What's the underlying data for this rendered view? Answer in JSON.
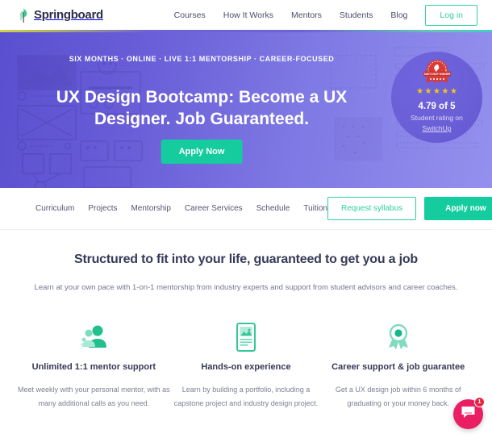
{
  "topnav": {
    "brand": "Springboard",
    "links": [
      {
        "label": "Courses"
      },
      {
        "label": "How It Works"
      },
      {
        "label": "Mentors"
      },
      {
        "label": "Students"
      },
      {
        "label": "Blog"
      }
    ],
    "login_label": "Log in"
  },
  "hero": {
    "eyebrow": "SIX MONTHS · ONLINE · LIVE 1:1 MENTORSHIP · CAREER-FOCUSED",
    "title": "UX Design Bootcamp: Become a UX Designer. Job Guaranteed.",
    "cta_label": "Apply Now",
    "rating": {
      "stars": 5,
      "score": "4.79 of 5",
      "caption": "Student rating on",
      "source": "SwitchUp"
    },
    "colors": {
      "gradient_start": "#5a4fcf",
      "gradient_end": "#9490ee",
      "cta_green": "#14cc9e"
    }
  },
  "subnav": {
    "links": [
      {
        "label": "Curriculum"
      },
      {
        "label": "Projects"
      },
      {
        "label": "Mentorship"
      },
      {
        "label": "Career Services"
      },
      {
        "label": "Schedule"
      },
      {
        "label": "Tuition"
      }
    ],
    "syllabus_label": "Request syllabus",
    "apply_label": "Apply now"
  },
  "main": {
    "title": "Structured to fit into your life, guaranteed to get you a job",
    "subtitle": "Learn at your own pace with 1-on-1 mentorship from industry experts and support from student advisors and career coaches.",
    "features": [
      {
        "icon": "mentor-people-icon",
        "title": "Unlimited 1:1 mentor support",
        "desc": "Meet weekly with your personal mentor, with as many additional calls as you need."
      },
      {
        "icon": "portfolio-device-icon",
        "title": "Hands-on experience",
        "desc": "Learn by building a portfolio, including a capstone project and industry design project."
      },
      {
        "icon": "award-ribbon-icon",
        "title": "Career support & job guarantee",
        "desc": "Get a UX design job within 6 months of graduating or your money back."
      }
    ]
  },
  "chat": {
    "icon": "chat-message-icon",
    "badge": "1",
    "color": "#e91e63"
  }
}
